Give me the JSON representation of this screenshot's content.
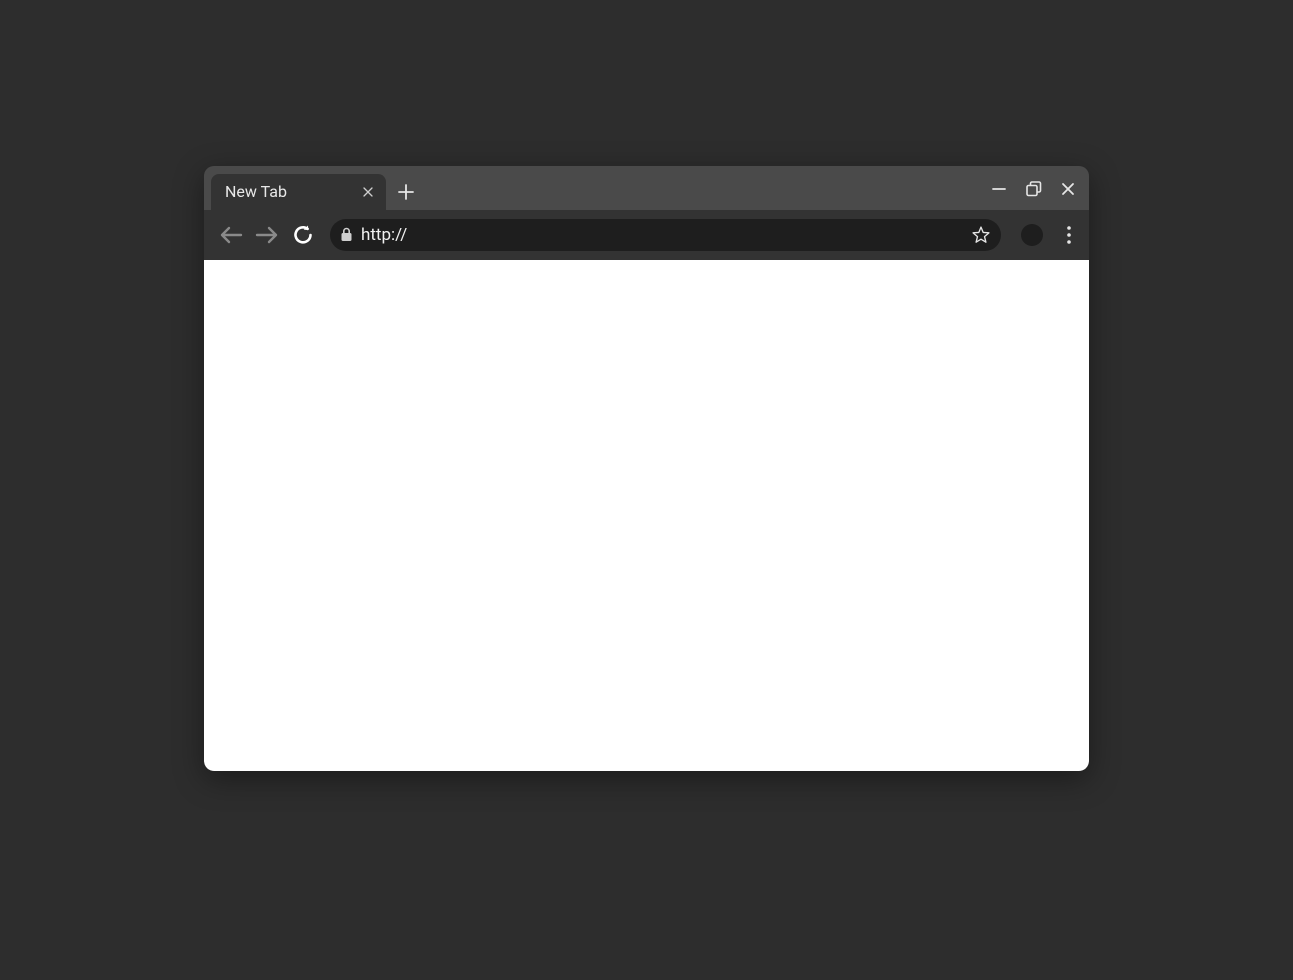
{
  "tab": {
    "title": "New Tab"
  },
  "address_bar": {
    "url": "http://"
  },
  "icons": {
    "close_tab": "close-icon",
    "new_tab": "plus-icon",
    "minimize": "minimize-icon",
    "maximize": "maximize-icon",
    "close_window": "close-icon",
    "back": "arrow-left-icon",
    "forward": "arrow-right-icon",
    "reload": "reload-icon",
    "lock": "lock-icon",
    "bookmark": "star-icon",
    "avatar": "profile-avatar",
    "menu": "kebab-menu-icon"
  },
  "colors": {
    "desktop_bg": "#2d2d2d",
    "tab_bar_bg": "#4a4a4a",
    "toolbar_bg": "#333333",
    "omnibox_bg": "#1e1e1e",
    "viewport_bg": "#ffffff",
    "text": "#e8e8e8",
    "icon_muted": "#8a8a8a"
  }
}
